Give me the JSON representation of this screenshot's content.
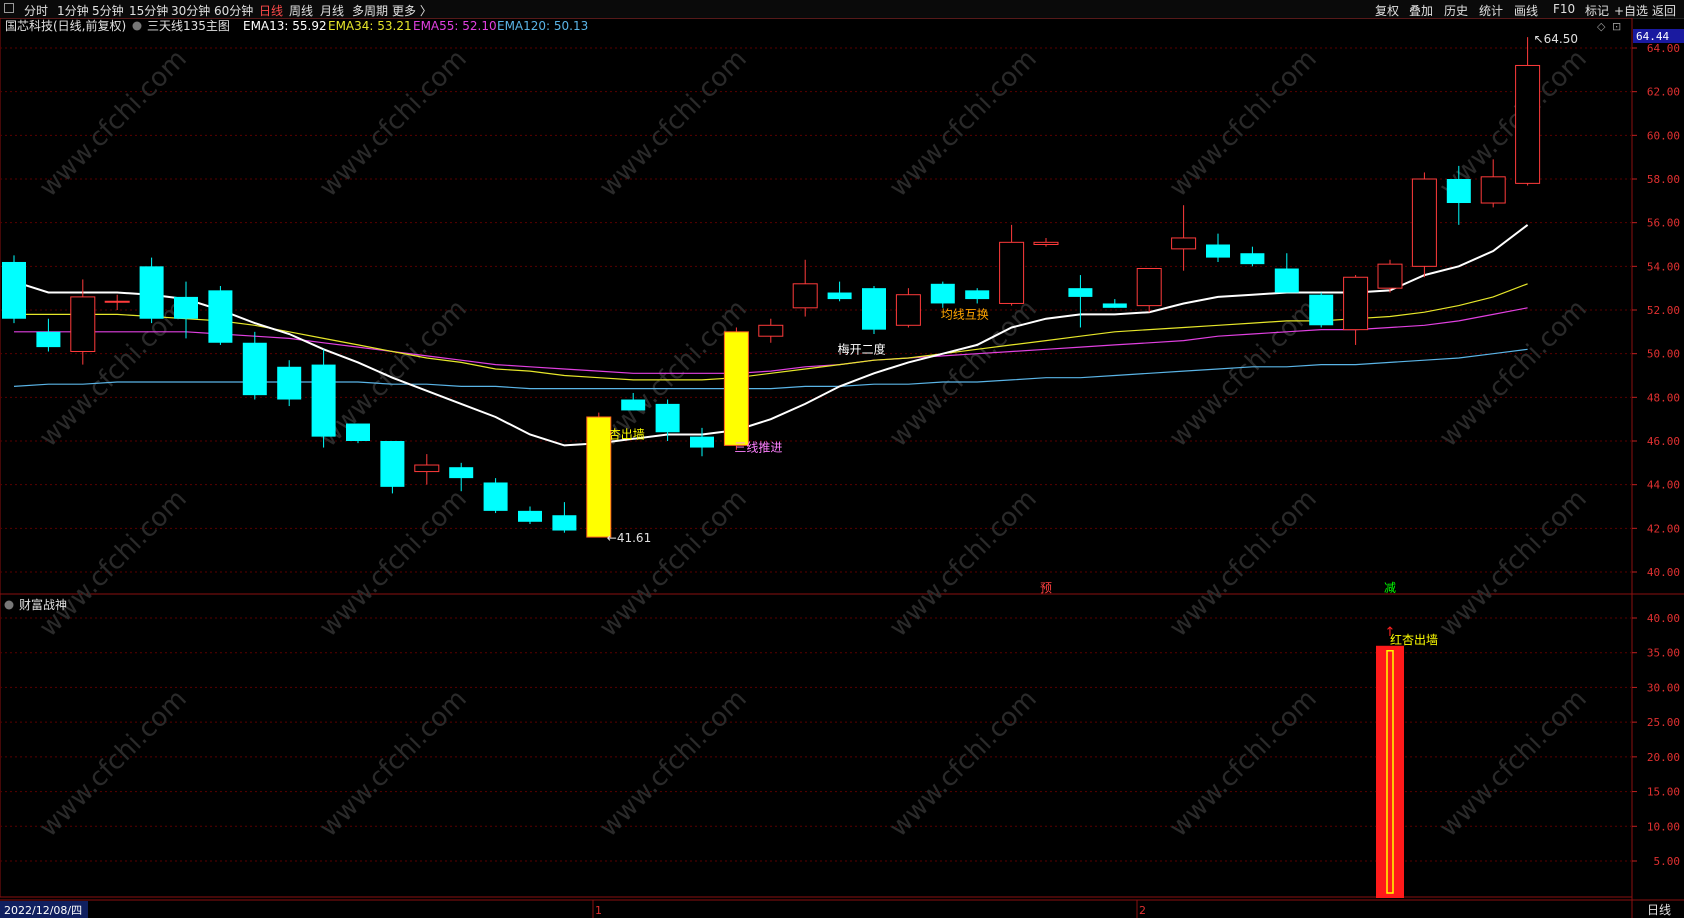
{
  "topbar": {
    "timeframes": [
      "分时",
      "1分钟",
      "5分钟",
      "15分钟",
      "30分钟",
      "60分钟",
      "日线",
      "周线",
      "月线",
      "多周期",
      "更多 〉"
    ],
    "active": "日线",
    "right_buttons": [
      "复权",
      "叠加",
      "历史",
      "统计",
      "画线",
      "F10",
      "标记",
      "+自选",
      "返回"
    ]
  },
  "info": {
    "stock": "国芯科技(日线,前复权)",
    "indicator": "三天线135主图",
    "ema13": "EMA13: 55.92",
    "ema34": "EMA34: 53.21",
    "ema55": "EMA55: 52.10",
    "ema120": "EMA120: 50.13"
  },
  "sub_title": "财富战神",
  "date_label": "2022/12/08/四",
  "period_label": "日线",
  "price_tag": "64.44",
  "month_marks": [
    "1",
    "2"
  ],
  "colors": {
    "up": "#ff3b3b",
    "down": "#00ffff",
    "ema13": "#ffffff",
    "ema34": "#e6e62a",
    "ema55": "#e040e0",
    "ema120": "#5ab4e6",
    "signal": "#ffff00",
    "grid": "#5a0000"
  },
  "chart_data": [
    {
      "type": "candlestick",
      "title": "国芯科技(日线,前复权)",
      "x": [
        "2022-12-08",
        "2022-12-09",
        "2022-12-12",
        "2022-12-13",
        "2022-12-14",
        "2022-12-15",
        "2022-12-16",
        "2022-12-19",
        "2022-12-20",
        "2022-12-21",
        "2022-12-22",
        "2022-12-23",
        "2022-12-26",
        "2022-12-27",
        "2022-12-28",
        "2022-12-29",
        "2022-12-30",
        "2023-01-03",
        "2023-01-04",
        "2023-01-05",
        "2023-01-06",
        "2023-01-09",
        "2023-01-10",
        "2023-01-11",
        "2023-01-12",
        "2023-01-13",
        "2023-01-16",
        "2023-01-17",
        "2023-01-18",
        "2023-01-19",
        "2023-01-20",
        "2023-01-30",
        "2023-01-31",
        "2023-02-01",
        "2023-02-02",
        "2023-02-03",
        "2023-02-06",
        "2023-02-07",
        "2023-02-08",
        "2023-02-09",
        "2023-02-10",
        "2023-02-13",
        "2023-02-14",
        "2023-02-15"
      ],
      "ohlc": [
        [
          54.2,
          54.5,
          51.4,
          51.6
        ],
        [
          51.0,
          51.6,
          50.1,
          50.3
        ],
        [
          50.1,
          53.4,
          49.5,
          52.6
        ],
        [
          52.4,
          52.7,
          52.0,
          52.4
        ],
        [
          54.0,
          54.4,
          51.4,
          51.6
        ],
        [
          52.6,
          53.3,
          50.7,
          51.6
        ],
        [
          52.9,
          53.1,
          50.4,
          50.5
        ],
        [
          50.5,
          51.0,
          47.9,
          48.1
        ],
        [
          49.4,
          49.7,
          47.6,
          47.9
        ],
        [
          49.5,
          50.2,
          45.7,
          46.2
        ],
        [
          46.8,
          46.8,
          45.9,
          46.0
        ],
        [
          46.0,
          46.0,
          43.6,
          43.9
        ],
        [
          44.6,
          45.4,
          44.0,
          44.9
        ],
        [
          44.8,
          45.0,
          43.7,
          44.3
        ],
        [
          44.1,
          44.3,
          42.7,
          42.8
        ],
        [
          42.8,
          43.0,
          42.2,
          42.3
        ],
        [
          42.6,
          43.2,
          41.8,
          41.9
        ],
        [
          41.6,
          47.3,
          41.6,
          47.1
        ],
        [
          47.9,
          48.2,
          47.4,
          47.4
        ],
        [
          47.7,
          47.9,
          46.0,
          46.4
        ],
        [
          46.2,
          46.6,
          45.3,
          45.7
        ],
        [
          45.8,
          51.2,
          45.6,
          51.0
        ],
        [
          50.8,
          51.6,
          50.5,
          51.3
        ],
        [
          52.1,
          54.3,
          51.7,
          53.2
        ],
        [
          52.8,
          53.3,
          52.4,
          52.5
        ],
        [
          53.0,
          53.1,
          50.9,
          51.1
        ],
        [
          51.3,
          53.0,
          51.2,
          52.7
        ],
        [
          53.2,
          53.3,
          52.1,
          52.3
        ],
        [
          52.9,
          53.0,
          52.3,
          52.5
        ],
        [
          52.3,
          55.9,
          52.2,
          55.1
        ],
        [
          55.0,
          55.3,
          54.9,
          55.1
        ],
        [
          53.0,
          53.6,
          51.2,
          52.6
        ],
        [
          52.3,
          52.5,
          52.1,
          52.1
        ],
        [
          52.2,
          53.4,
          51.9,
          53.9
        ],
        [
          54.8,
          56.8,
          53.8,
          55.3
        ],
        [
          55.0,
          55.5,
          54.2,
          54.4
        ],
        [
          54.6,
          54.9,
          54.0,
          54.1
        ],
        [
          53.9,
          54.6,
          52.8,
          52.8
        ],
        [
          52.7,
          52.8,
          51.2,
          51.3
        ],
        [
          51.1,
          53.6,
          50.4,
          53.5
        ],
        [
          53.0,
          54.3,
          52.8,
          54.1
        ],
        [
          54.0,
          58.3,
          53.5,
          58.0
        ],
        [
          58.0,
          58.6,
          55.9,
          56.9
        ],
        [
          56.9,
          58.9,
          56.7,
          58.1
        ],
        [
          57.8,
          64.5,
          57.7,
          63.2
        ]
      ],
      "ema13": [
        53.3,
        52.8,
        52.8,
        52.8,
        52.7,
        52.5,
        52.0,
        51.4,
        50.9,
        50.2,
        49.6,
        48.9,
        48.3,
        47.7,
        47.1,
        46.3,
        45.8,
        45.9,
        46.1,
        46.3,
        46.3,
        46.5,
        47.0,
        47.7,
        48.5,
        49.1,
        49.6,
        50.0,
        50.4,
        51.2,
        51.6,
        51.8,
        51.8,
        51.9,
        52.3,
        52.6,
        52.7,
        52.8,
        52.8,
        52.8,
        52.9,
        53.6,
        54.0,
        54.7,
        55.9
      ],
      "ema34": [
        51.8,
        51.8,
        51.8,
        51.8,
        51.7,
        51.6,
        51.5,
        51.3,
        51.0,
        50.7,
        50.4,
        50.1,
        49.8,
        49.6,
        49.3,
        49.2,
        49.0,
        48.9,
        48.8,
        48.8,
        48.8,
        48.9,
        49.1,
        49.3,
        49.5,
        49.7,
        49.8,
        50.0,
        50.2,
        50.4,
        50.6,
        50.8,
        51.0,
        51.1,
        51.2,
        51.3,
        51.4,
        51.5,
        51.5,
        51.6,
        51.7,
        51.9,
        52.2,
        52.6,
        53.2
      ],
      "ema55": [
        51.0,
        51.0,
        51.0,
        51.0,
        51.0,
        51.0,
        50.9,
        50.8,
        50.7,
        50.5,
        50.3,
        50.1,
        49.9,
        49.7,
        49.5,
        49.4,
        49.3,
        49.2,
        49.1,
        49.1,
        49.1,
        49.1,
        49.2,
        49.4,
        49.5,
        49.7,
        49.8,
        49.9,
        50.0,
        50.1,
        50.2,
        50.3,
        50.4,
        50.5,
        50.6,
        50.8,
        50.9,
        51.0,
        51.1,
        51.1,
        51.2,
        51.3,
        51.5,
        51.8,
        52.1
      ],
      "ema120": [
        48.5,
        48.6,
        48.6,
        48.7,
        48.7,
        48.7,
        48.7,
        48.7,
        48.7,
        48.7,
        48.7,
        48.6,
        48.6,
        48.5,
        48.5,
        48.4,
        48.4,
        48.4,
        48.4,
        48.4,
        48.4,
        48.4,
        48.4,
        48.5,
        48.5,
        48.6,
        48.6,
        48.7,
        48.7,
        48.8,
        48.9,
        48.9,
        49.0,
        49.1,
        49.2,
        49.3,
        49.4,
        49.4,
        49.5,
        49.5,
        49.6,
        49.7,
        49.8,
        50.0,
        50.2
      ],
      "ylim": [
        39.5,
        65.2
      ],
      "yticks": [
        40,
        42,
        44,
        46,
        48,
        50,
        52,
        54,
        56,
        58,
        60,
        62,
        64
      ],
      "annotations": [
        {
          "index": 17,
          "text": "红杏出墙",
          "price": 46.3,
          "color": "#ffff00"
        },
        {
          "index": 21,
          "text": "三线推进",
          "price": 45.7,
          "color": "#ff80ff"
        },
        {
          "index": 24,
          "text": "梅开二度",
          "price": 50.2,
          "color": "#ffffff"
        },
        {
          "index": 27,
          "text": "均线互换",
          "price": 51.8,
          "color": "#ffa500"
        },
        {
          "index": 30,
          "text": "预",
          "color": "#ff4040",
          "position": "bottom"
        },
        {
          "index": 40,
          "text": "减",
          "color": "#00ff00",
          "position": "bottom"
        }
      ],
      "min_label": "41.61",
      "max_label": "64.50",
      "highlight_bars": [
        17,
        21
      ]
    },
    {
      "type": "bar",
      "title": "财富战神",
      "bar_index": 40,
      "value": 36,
      "signal_text": "红杏出墙",
      "ylim": [
        0,
        42.5
      ],
      "yticks": [
        5,
        10,
        15,
        20,
        25,
        30,
        35,
        40
      ]
    }
  ]
}
